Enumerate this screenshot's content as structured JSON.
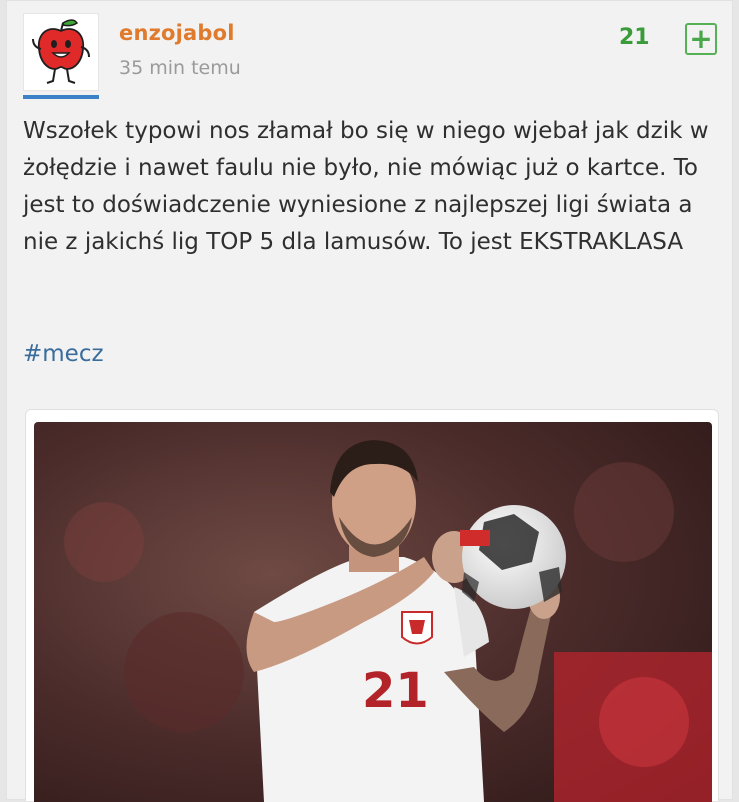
{
  "post": {
    "author": "enzojabol",
    "time": "35 min temu",
    "votes": "21",
    "plus_label": "+",
    "content": "Wszołek typowi nos złamał bo się w niego wjebał jak dzik w żołędzie i nawet faulu nie było, nie mówiąc już o kartce. To jest to doświadczenie wyniesione z najlepszej ligi świata a nie z jakichś lig TOP 5 dla lamusów. To jest EKSTRAKLASA",
    "tag": "#mecz",
    "image": {
      "shirt_number": "21"
    }
  },
  "colors": {
    "author": "#e07a2c",
    "votes": "#3a9b3a",
    "tag": "#3a6c9c",
    "avatar_accent": "#3b83c6"
  }
}
